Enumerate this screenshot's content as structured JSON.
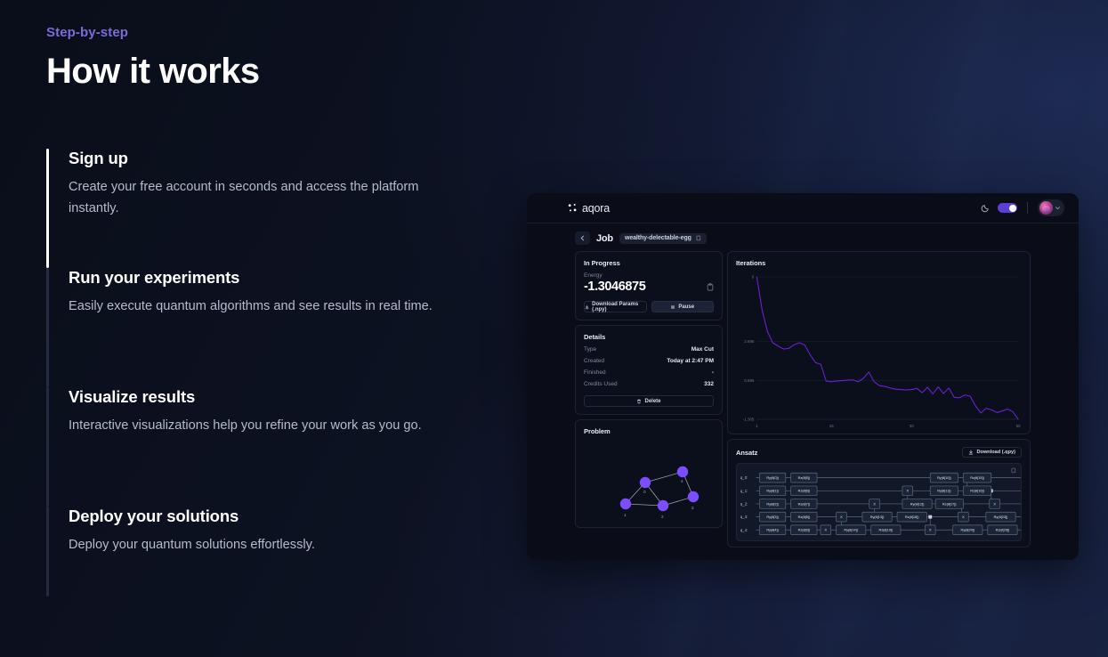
{
  "header": {
    "eyebrow": "Step-by-step",
    "title": "How it works"
  },
  "steps": [
    {
      "title": "Sign up",
      "desc": "Create your free account in seconds and access the platform instantly.",
      "active": true
    },
    {
      "title": "Run your experiments",
      "desc": "Easily execute quantum algorithms and see results in real time.",
      "active": false
    },
    {
      "title": "Visualize results",
      "desc": "Interactive visualizations help you refine your work as you go.",
      "active": false
    },
    {
      "title": "Deploy your solutions",
      "desc": "Deploy your quantum solutions effortlessly.",
      "active": false
    }
  ],
  "app": {
    "brand": "aqora",
    "topbar": {
      "theme_icon": "moon-icon",
      "theme_toggle_on": true,
      "avatar_chevron": "chevron-down-icon"
    },
    "breadcrumb": {
      "back_icon": "arrow-left-icon",
      "label": "Job",
      "job_id": "wealthy-delectable-egg",
      "copy_icon": "copy-icon"
    },
    "in_progress": {
      "title": "In Progress",
      "energy_label": "Energy",
      "energy_value": "-1.3046875",
      "copy_icon": "clipboard-icon",
      "download_button": "Download Params (.npy)",
      "pause_button": "Pause"
    },
    "details": {
      "title": "Details",
      "rows": [
        {
          "key": "Type",
          "value": "Max Cut"
        },
        {
          "key": "Created",
          "value": "Today at 2:47 PM"
        },
        {
          "key": "Finished",
          "value": "-"
        },
        {
          "key": "Credits Used",
          "value": "332"
        }
      ],
      "delete_button": "Delete"
    },
    "iterations": {
      "title": "Iterations"
    },
    "problem": {
      "title": "Problem",
      "node_labels": [
        "0",
        "1",
        "2",
        "3",
        "4"
      ],
      "node_color": "#7c4dff"
    },
    "ansatz": {
      "title": "Ansatz",
      "download_button": "Download (.qpy)",
      "copy_icon": "copy-icon",
      "qubit_labels": [
        "q_0:",
        "q_1:",
        "q_2:",
        "q_3:",
        "q_4:"
      ],
      "gate_rows": [
        [
          "Ry(θ[0])",
          "Rz(θ[5])",
          "Ry(θ[10])",
          "Rz(θ[15])"
        ],
        [
          "Ry(θ[1])",
          "Rz(θ[6])",
          "X",
          "Ry(θ[11])",
          "Rz(θ[16])"
        ],
        [
          "Ry(θ[2])",
          "Rz(θ[7])",
          "X",
          "Ry(θ[12])",
          "Rz(θ[17])",
          "X"
        ],
        [
          "Ry(θ[3])",
          "Rz(θ[8])",
          "X",
          "Ry(θ[13])",
          "Rz(θ[18])",
          "X",
          "Ry(θ[23])"
        ],
        [
          "Ry(θ[4])",
          "Rz(θ[9])",
          "X",
          "Ry(θ[14])",
          "Rz(θ[19])",
          "X",
          "Ry(θ[24])",
          "Rz(θ[29])"
        ]
      ]
    }
  },
  "chart_data": {
    "type": "line",
    "title": "Iterations",
    "xlabel": "",
    "ylabel": "",
    "xticks": [
      "1",
      "15",
      "30",
      "50"
    ],
    "yticks": [
      "6",
      "2.695",
      "0.695",
      "-1.305"
    ],
    "ylim": [
      -1.305,
      6.0
    ],
    "xlim": [
      1,
      50
    ],
    "grid": true,
    "line_color": "#6b21d4",
    "x": [
      1,
      2,
      3,
      4,
      5,
      6,
      7,
      8,
      9,
      10,
      11,
      12,
      13,
      14,
      15,
      16,
      17,
      18,
      19,
      20,
      21,
      22,
      23,
      24,
      25,
      26,
      27,
      28,
      29,
      30,
      31,
      32,
      33,
      34,
      35,
      36,
      37,
      38,
      39,
      40,
      41,
      42,
      43,
      44,
      45,
      46,
      47,
      48,
      49,
      50
    ],
    "values": [
      6.0,
      4.3,
      3.2,
      2.62,
      2.45,
      2.3,
      2.33,
      2.52,
      2.62,
      2.5,
      2.0,
      1.6,
      1.52,
      0.66,
      0.62,
      0.66,
      0.68,
      0.7,
      0.72,
      0.62,
      0.8,
      1.12,
      0.62,
      0.42,
      0.38,
      0.3,
      0.24,
      0.22,
      0.2,
      0.22,
      0.28,
      0.06,
      0.34,
      0.0,
      0.36,
      0.02,
      0.3,
      -0.18,
      -0.2,
      -0.06,
      -0.12,
      -0.62,
      -0.98,
      -0.74,
      -0.82,
      -0.96,
      -0.88,
      -0.78,
      -0.92,
      -1.3
    ]
  }
}
